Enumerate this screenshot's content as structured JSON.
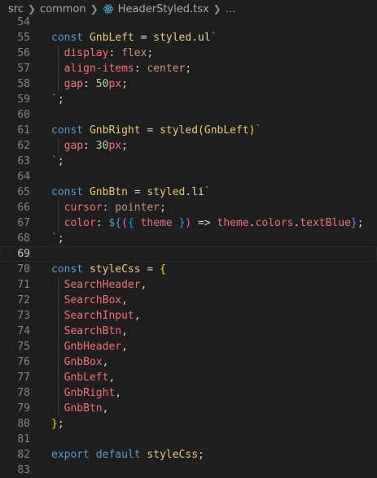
{
  "breadcrumb": {
    "items": [
      "src",
      "common",
      "HeaderStyled.tsx",
      "..."
    ],
    "file_icon": "react-icon"
  },
  "editor": {
    "current_line": 69,
    "lines": [
      {
        "n": "54",
        "tokens": []
      },
      {
        "n": "55",
        "tokens": [
          [
            "kw",
            "const "
          ],
          [
            "comp",
            "GnbLeft"
          ],
          [
            "op",
            " = "
          ],
          [
            "comp",
            "styled"
          ],
          [
            "op",
            "."
          ],
          [
            "fn",
            "ul"
          ],
          [
            "tpl",
            "`"
          ]
        ]
      },
      {
        "n": "56",
        "guide": true,
        "tokens": [
          [
            "sp",
            "  "
          ],
          [
            "prop",
            "display"
          ],
          [
            "op",
            ": "
          ],
          [
            "val",
            "flex"
          ],
          [
            "op",
            ";"
          ]
        ]
      },
      {
        "n": "57",
        "guide": true,
        "tokens": [
          [
            "sp",
            "  "
          ],
          [
            "prop",
            "align-items"
          ],
          [
            "op",
            ": "
          ],
          [
            "val",
            "center"
          ],
          [
            "op",
            ";"
          ]
        ]
      },
      {
        "n": "58",
        "guide": true,
        "tokens": [
          [
            "sp",
            "  "
          ],
          [
            "prop",
            "gap"
          ],
          [
            "op",
            ": "
          ],
          [
            "num",
            "50"
          ],
          [
            "unit",
            "px"
          ],
          [
            "op",
            ";"
          ]
        ]
      },
      {
        "n": "59",
        "tokens": [
          [
            "tpl",
            "`"
          ],
          [
            "op",
            ";"
          ]
        ]
      },
      {
        "n": "60",
        "tokens": []
      },
      {
        "n": "61",
        "tokens": [
          [
            "kw",
            "const "
          ],
          [
            "comp",
            "GnbRight"
          ],
          [
            "op",
            " = "
          ],
          [
            "comp",
            "styled"
          ],
          [
            "brk1",
            "("
          ],
          [
            "comp",
            "GnbLeft"
          ],
          [
            "brk1",
            ")"
          ],
          [
            "tpl",
            "`"
          ]
        ]
      },
      {
        "n": "62",
        "guide": true,
        "tokens": [
          [
            "sp",
            "  "
          ],
          [
            "prop",
            "gap"
          ],
          [
            "op",
            ": "
          ],
          [
            "num",
            "30"
          ],
          [
            "unit",
            "px"
          ],
          [
            "op",
            ";"
          ]
        ]
      },
      {
        "n": "63",
        "tokens": [
          [
            "tpl",
            "`"
          ],
          [
            "op",
            ";"
          ]
        ]
      },
      {
        "n": "64",
        "tokens": []
      },
      {
        "n": "65",
        "tokens": [
          [
            "kw",
            "const "
          ],
          [
            "comp",
            "GnbBtn"
          ],
          [
            "op",
            " = "
          ],
          [
            "comp",
            "styled"
          ],
          [
            "op",
            "."
          ],
          [
            "fn",
            "li"
          ],
          [
            "tpl",
            "`"
          ]
        ]
      },
      {
        "n": "66",
        "guide": true,
        "tokens": [
          [
            "sp",
            "  "
          ],
          [
            "prop",
            "cursor"
          ],
          [
            "op",
            ": "
          ],
          [
            "val",
            "pointer"
          ],
          [
            "op",
            ";"
          ]
        ]
      },
      {
        "n": "67",
        "guide": true,
        "tokens": [
          [
            "sp",
            "  "
          ],
          [
            "prop",
            "color"
          ],
          [
            "op",
            ": "
          ],
          [
            "interp",
            "${"
          ],
          [
            "brk2",
            "("
          ],
          [
            "brk3",
            "{"
          ],
          [
            "op",
            " "
          ],
          [
            "arg",
            "theme"
          ],
          [
            "op",
            " "
          ],
          [
            "brk3",
            "}"
          ],
          [
            "brk2",
            ")"
          ],
          [
            "op",
            " => "
          ],
          [
            "arg",
            "theme"
          ],
          [
            "op",
            "."
          ],
          [
            "arg",
            "colors"
          ],
          [
            "op",
            "."
          ],
          [
            "arg",
            "textBlue"
          ],
          [
            "interp",
            "}"
          ],
          [
            "op",
            ";"
          ]
        ]
      },
      {
        "n": "68",
        "tokens": [
          [
            "tpl",
            "`"
          ],
          [
            "op",
            ";"
          ]
        ]
      },
      {
        "n": "69",
        "tokens": []
      },
      {
        "n": "70",
        "tokens": [
          [
            "kw",
            "const "
          ],
          [
            "comp",
            "styleCss"
          ],
          [
            "op",
            " = "
          ],
          [
            "brk1",
            "{"
          ]
        ]
      },
      {
        "n": "71",
        "guide": true,
        "tokens": [
          [
            "sp",
            "  "
          ],
          [
            "ident",
            "SearchHeader"
          ],
          [
            "op",
            ","
          ]
        ]
      },
      {
        "n": "72",
        "guide": true,
        "tokens": [
          [
            "sp",
            "  "
          ],
          [
            "ident",
            "SearchBox"
          ],
          [
            "op",
            ","
          ]
        ]
      },
      {
        "n": "73",
        "guide": true,
        "tokens": [
          [
            "sp",
            "  "
          ],
          [
            "ident",
            "SearchInput"
          ],
          [
            "op",
            ","
          ]
        ]
      },
      {
        "n": "74",
        "guide": true,
        "tokens": [
          [
            "sp",
            "  "
          ],
          [
            "ident",
            "SearchBtn"
          ],
          [
            "op",
            ","
          ]
        ]
      },
      {
        "n": "75",
        "guide": true,
        "tokens": [
          [
            "sp",
            "  "
          ],
          [
            "ident",
            "GnbHeader"
          ],
          [
            "op",
            ","
          ]
        ]
      },
      {
        "n": "76",
        "guide": true,
        "tokens": [
          [
            "sp",
            "  "
          ],
          [
            "ident",
            "GnbBox"
          ],
          [
            "op",
            ","
          ]
        ]
      },
      {
        "n": "77",
        "guide": true,
        "tokens": [
          [
            "sp",
            "  "
          ],
          [
            "ident",
            "GnbLeft"
          ],
          [
            "op",
            ","
          ]
        ]
      },
      {
        "n": "78",
        "guide": true,
        "tokens": [
          [
            "sp",
            "  "
          ],
          [
            "ident",
            "GnbRight"
          ],
          [
            "op",
            ","
          ]
        ]
      },
      {
        "n": "79",
        "guide": true,
        "tokens": [
          [
            "sp",
            "  "
          ],
          [
            "ident",
            "GnbBtn"
          ],
          [
            "op",
            ","
          ]
        ]
      },
      {
        "n": "80",
        "tokens": [
          [
            "brk1",
            "}"
          ],
          [
            "op",
            ";"
          ]
        ]
      },
      {
        "n": "81",
        "tokens": []
      },
      {
        "n": "82",
        "tokens": [
          [
            "kw",
            "export "
          ],
          [
            "kw",
            "default "
          ],
          [
            "comp",
            "styleCss"
          ],
          [
            "op",
            ";"
          ]
        ]
      },
      {
        "n": "83",
        "tokens": []
      }
    ]
  }
}
